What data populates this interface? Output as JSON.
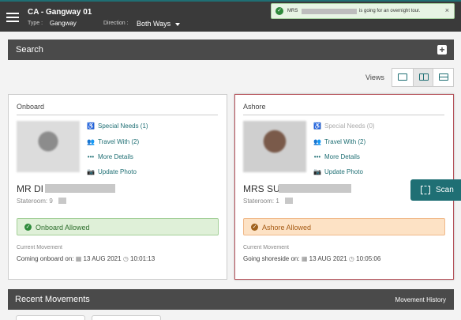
{
  "header": {
    "title": "CA - Gangway 01",
    "type_label": "Type :",
    "type_value": "Gangway",
    "direction_label": "Direction :",
    "direction_value": "Both Ways"
  },
  "toast": {
    "prefix": "MRS",
    "message": "is going for an overnight tour.",
    "close": "×"
  },
  "search": {
    "label": "Search",
    "add": "+"
  },
  "views": {
    "label": "Views"
  },
  "onboard": {
    "heading": "Onboard",
    "links": [
      "Special Needs (1)",
      "Travel With (2)",
      "More Details",
      "Update Photo"
    ],
    "name": "MR DI",
    "stateroom": "Stateroom: 9",
    "status": "Onboard Allowed",
    "movement_label": "Current Movement",
    "movement_text": "Coming onboard on:",
    "date": "13 AUG 2021",
    "time": "10:01:13"
  },
  "ashore": {
    "heading": "Ashore",
    "links": [
      "Special Needs (0)",
      "Travel With (2)",
      "More Details",
      "Update Photo"
    ],
    "name": "MRS SU",
    "stateroom": "Stateroom: 1",
    "status": "Ashore Allowed",
    "movement_label": "Current Movement",
    "movement_text": "Going shoreside on:",
    "date": "13 AUG 2021",
    "time": "10:05:06"
  },
  "scan": {
    "label": "Scan"
  },
  "recent": {
    "label": "Recent Movements",
    "history": "Movement History"
  },
  "colors": {
    "accent": "#1f6f74",
    "header_bg": "#3a3a3a",
    "bar_bg": "#4a4a4a",
    "ashore_border": "#b5525a"
  }
}
